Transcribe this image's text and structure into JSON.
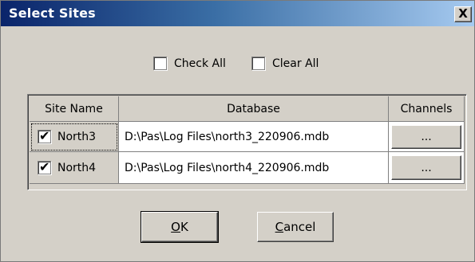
{
  "dialog": {
    "title": "Select Sites",
    "close_glyph": "X"
  },
  "options": {
    "check_all_label": "Check All",
    "check_all_checked": false,
    "clear_all_label": "Clear All",
    "clear_all_checked": false
  },
  "grid": {
    "columns": [
      "Site Name",
      "Database",
      "Channels"
    ],
    "rows": [
      {
        "site": "North3",
        "checked": true,
        "database": "D:\\Pas\\Log Files\\north3_220906.mdb",
        "channels": "..."
      },
      {
        "site": "North4",
        "checked": true,
        "database": "D:\\Pas\\Log Files\\north4_220906.mdb",
        "channels": "..."
      }
    ]
  },
  "buttons": {
    "ok_accel": "O",
    "ok_rest": "K",
    "cancel_accel": "C",
    "cancel_rest": "ancel"
  },
  "icons": {
    "close": "close-icon",
    "check": "checkmark-icon"
  },
  "colors": {
    "titlebar_start": "#0a246a",
    "titlebar_end": "#a6caf0",
    "face": "#d4d0c8"
  }
}
